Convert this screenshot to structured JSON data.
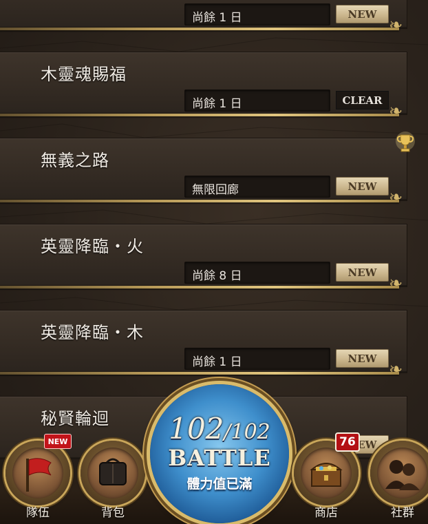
{
  "quests": [
    {
      "title": "",
      "remaining": "尚餘 1 日",
      "badge": "NEW",
      "badge_type": "new"
    },
    {
      "title": "木靈魂賜福",
      "remaining": "尚餘 1 日",
      "badge": "CLEAR",
      "badge_type": "clear"
    },
    {
      "title": "無義之路",
      "remaining": "無限回廊",
      "badge": "NEW",
      "badge_type": "new"
    },
    {
      "title": "英靈降臨・火",
      "remaining": "尚餘 8 日",
      "badge": "NEW",
      "badge_type": "new"
    },
    {
      "title": "英靈降臨・木",
      "remaining": "尚餘 1 日",
      "badge": "NEW",
      "badge_type": "new"
    },
    {
      "title": "秘賢輪迴",
      "remaining": "",
      "badge": "NEW",
      "badge_type": "new"
    }
  ],
  "nav": {
    "team": {
      "label": "隊伍",
      "tag": "NEW"
    },
    "bag": {
      "label": "背包"
    },
    "battle": {
      "stamina_current": "102",
      "stamina_max": "/102",
      "label": "BATTLE",
      "status": "體力值已滿"
    },
    "shop": {
      "label": "商店",
      "count": "76"
    },
    "social": {
      "label": "社群"
    }
  },
  "colors": {
    "accent_gold": "#c9a65a",
    "badge_red": "#c2141a",
    "battle_blue": "#3f8fcc"
  }
}
